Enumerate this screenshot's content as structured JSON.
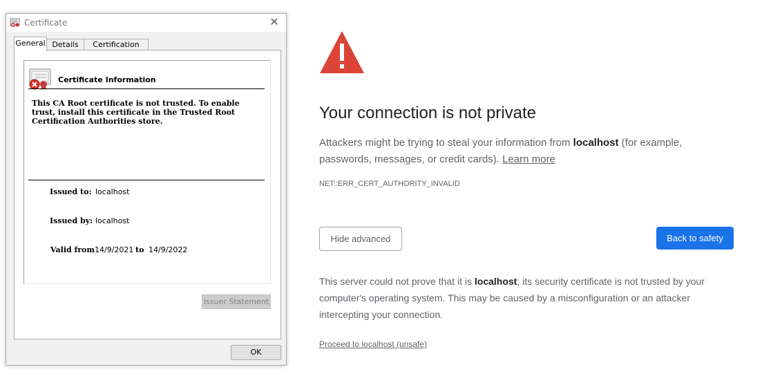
{
  "dialog": {
    "title": "Certificate",
    "close_glyph": "✕",
    "tabs": [
      {
        "label": "General",
        "active": true
      },
      {
        "label": "Details",
        "active": false
      },
      {
        "label": "Certification Path",
        "active": false
      }
    ],
    "info_title": "Certificate Information",
    "info_message": "This CA Root certificate is not trusted. To enable trust, install this certificate in the Trusted Root Certification Authorities store.",
    "issued_to_label": "Issued to:",
    "issued_to_value": "localhost",
    "issued_by_label": "Issued by:",
    "issued_by_value": "localhost",
    "valid_from_label": "Valid from",
    "valid_from_value": "14/9/2021",
    "valid_to_label": "to",
    "valid_to_value": "14/9/2022",
    "issuer_statement_label": "Issuer Statement",
    "ok_label": "OK"
  },
  "interstitial": {
    "heading": "Your connection is not private",
    "intro_before": "Attackers might be trying to steal your information from ",
    "intro_host": "localhost",
    "intro_after": " (for example, passwords, messages, or credit cards). ",
    "learn_more": "Learn more",
    "error_code": "NET::ERR_CERT_AUTHORITY_INVALID",
    "hide_advanced": "Hide advanced",
    "back_to_safety": "Back to safety",
    "explain_before": "This server could not prove that it is ",
    "explain_host": "localhost",
    "explain_after": "; its security certificate is not trusted by your computer's operating system. This may be caused by a misconfiguration or an attacker intercepting your connection.",
    "proceed_link": "Proceed to localhost (unsafe)"
  },
  "colors": {
    "warning_red": "#db4437",
    "primary_blue": "#1a73e8",
    "text_gray": "#5f6368"
  },
  "icons": {
    "title_icon": "certificate-icon",
    "warning_icon": "warning-triangle-icon",
    "cert_info_icon": "untrusted-certificate-icon"
  }
}
